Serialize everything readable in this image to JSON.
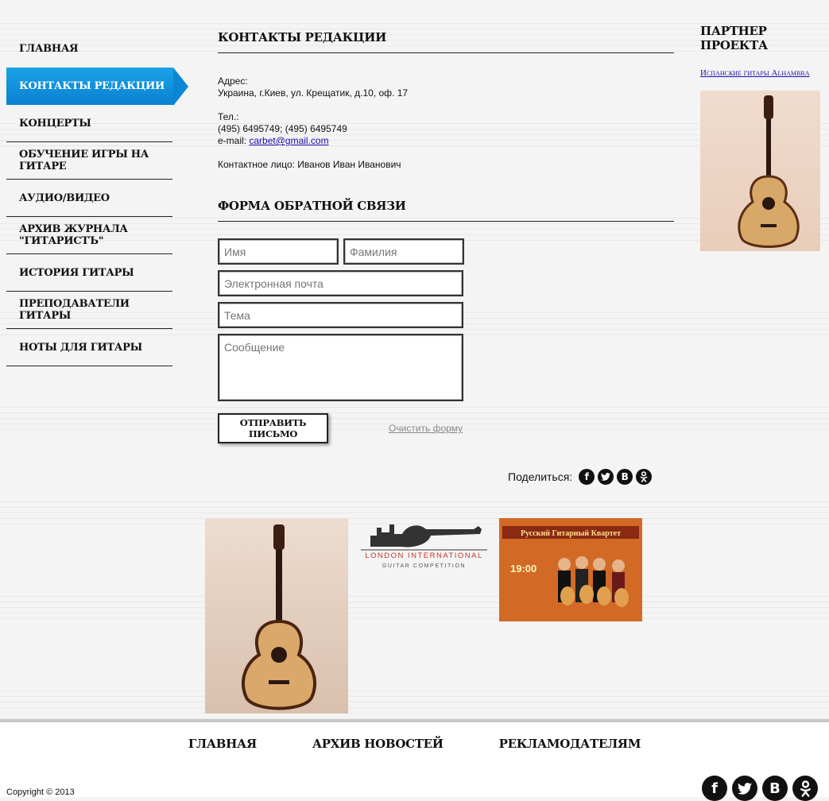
{
  "nav": {
    "items": [
      {
        "label": "Главная"
      },
      {
        "label": "Контакты редакции"
      },
      {
        "label": "Концерты"
      },
      {
        "label": "Обучение игры на гитаре"
      },
      {
        "label": "Аудио/видео"
      },
      {
        "label": "Архив журнала \"Гитаристъ\""
      },
      {
        "label": "История гитары"
      },
      {
        "label": "Преподаватели гитары"
      },
      {
        "label": "Ноты для гитары"
      }
    ],
    "active_label": "Контакты редакции"
  },
  "contacts": {
    "title": "Контакты редакции",
    "address_label": "Адрес:",
    "address": "Украина, г.Киев, ул. Крещатик, д.10, оф. 17",
    "phone_label": "Тел.:",
    "phones": "(495) 6495749; (495) 6495749",
    "email_label": "e-mail:",
    "email": "carbet@gmail.com",
    "contact_person": "Контактное лицо: Иванов Иван Иванович"
  },
  "form": {
    "title": "Форма обратной связи",
    "first_name_placeholder": "Имя",
    "last_name_placeholder": "Фамилия",
    "email_placeholder": "Электронная почта",
    "subject_placeholder": "Тема",
    "message_placeholder": "Сообщение",
    "submit_label": "Отправить письмо",
    "clear_label": "Очистить форму"
  },
  "share": {
    "label": "Поделиться:",
    "icons": [
      "facebook-icon",
      "twitter-icon",
      "vk-icon",
      "odnoklassniki-icon"
    ]
  },
  "partner": {
    "title": "Партнер проекта",
    "link": "Испанские гитары Alhambra"
  },
  "banners": {
    "london_line1": "LONDON INTERNATIONAL",
    "london_line2": "GUITAR COMPETITION",
    "quartet_title": "Русский Гитарный Квартет",
    "quartet_time": "19:00"
  },
  "footer": {
    "nav": [
      "Главная",
      "Архив новостей",
      "Рекламодателям"
    ],
    "copyright": "Copyright © 2013"
  },
  "colors": {
    "accent_blue": "#0a80d0",
    "link": "#1a0dab"
  }
}
